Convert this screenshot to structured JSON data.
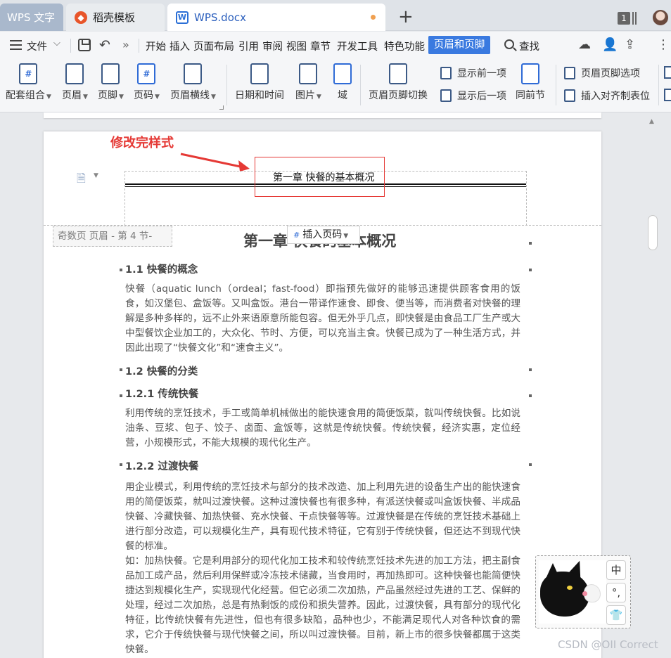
{
  "tabs": {
    "wps": "WPS 文字",
    "template": "稻壳模板",
    "doc": "WPS.docx",
    "template_icon": "daoke-logo-icon",
    "doc_icon": "word-doc-icon"
  },
  "window": {
    "count": "1"
  },
  "menu": {
    "file": "文件",
    "items": [
      "开始",
      "插入",
      "页面布局",
      "引用",
      "审阅",
      "视图",
      "章节",
      "开发工具",
      "特色功能"
    ],
    "active": "页眉和页脚",
    "search": "查找"
  },
  "ribbon": {
    "preset": "配套组合",
    "header": "页眉",
    "footer": "页脚",
    "page_number": "页码",
    "header_line": "页眉横线",
    "datetime": "日期和时间",
    "picture": "图片",
    "field": "域",
    "switch": "页眉页脚切换",
    "show_prev": "显示前一项",
    "show_next": "显示后一项",
    "same_as_prev": "同前节",
    "options": "页眉页脚选项",
    "insert_align_tab": "插入对齐制表位"
  },
  "annotation": {
    "label": "修改完样式"
  },
  "header": {
    "text": "第一章 快餐的基本概况",
    "section_tag": "奇数页 页眉  - 第 4 节-",
    "insert_page_number": "插入页码"
  },
  "document": {
    "title": "第一章 快餐的基本概况",
    "h_1_1": "1.1 快餐的概念",
    "p_1_1": "快餐（aquatic lunch（ordeal；fast-food）即指预先做好的能够迅速提供顾客食用的饭食，如汉堡包、盒饭等。又叫盒饭。港台一带译作速食、即食、便当等，而消费者对快餐的理解是多种多样的，远不止外来语原意所能包容。但无外乎几点，即快餐是由食品工厂生产或大中型餐饮企业加工的，大众化、节时、方便，可以充当主食。快餐已成为了一种生活方式，并因此出现了“快餐文化”和“速食主义”。",
    "h_1_2": "1.2 快餐的分类",
    "h_1_2_1": "1.2.1 传统快餐",
    "p_1_2_1": "利用传统的烹饪技术，手工或简单机械做出的能快速食用的简便饭菜，就叫传统快餐。比如说油条、豆浆、包子、饺子、卤面、盒饭等，这就是传统快餐。传统快餐，经济实惠，定位经营，小规模形式，不能大规模的现代化生产。",
    "h_1_2_2": "1.2.2 过渡快餐",
    "p_1_2_2a": "用企业模式，利用传统的烹饪技术与部分的技术改造、加上利用先进的设备生产出的能快速食用的简便饭菜，就叫过渡快餐。这种过渡快餐也有很多种，有派送快餐或叫盒饭快餐、半成品快餐、冷藏快餐、加热快餐、充水快餐、干点快餐等等。过渡快餐是在传统的烹饪技术基础上进行部分改造，可以规模化生产，具有现代技术特征，它有别于传统快餐，但还达不到现代快餐的标准。",
    "p_1_2_2b": "如：加热快餐。它是利用部分的现代化加工技术和较传统烹饪技术先进的加工方法，把主副食品加工成产品，然后利用保鲜或冷冻技术储藏，当食用时，再加热即可。这种快餐也能简便快捷达到规模化生产，实现现代化经营。但它必须二次加热，产品虽然经过先进的工艺、保鲜的处理，经过二次加热，总是有热剩饭的成份和损失营养。因此，过渡快餐，具有部分的现代化特征，比传统快餐有先进性，但也有很多缺陷，品种也少，不能满足现代人对各种饮食的需求，它介于传统快餐与现代快餐之间，所以叫过渡快餐。目前，新上市的很多快餐都属于这类快餐。"
  },
  "ime_widget": {
    "lang": "中",
    "punct": "°,",
    "skin_icon": "shirt-icon"
  },
  "watermark": "CSDN @OII Correct",
  "colors": {
    "accent": "#3a7ae0",
    "annotation": "#e53935"
  }
}
